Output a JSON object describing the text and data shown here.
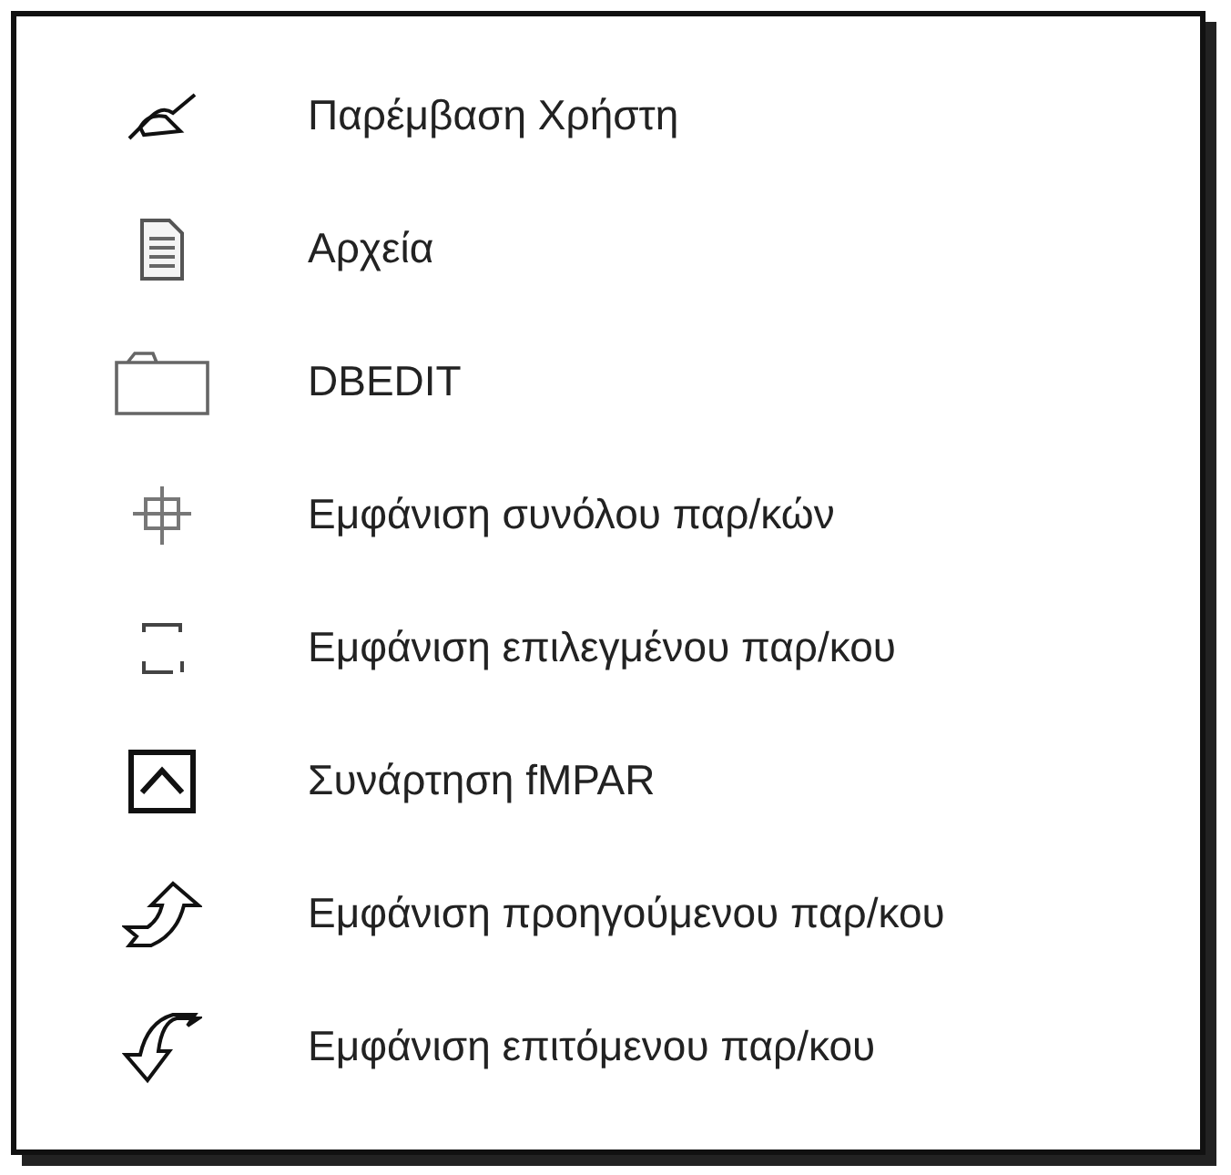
{
  "menu": {
    "items": [
      {
        "kind": "edit",
        "label": "Παρέμβαση Χρήστη"
      },
      {
        "kind": "file",
        "label": "Αρχεία"
      },
      {
        "kind": "folder",
        "label": "DBEDIT"
      },
      {
        "kind": "tree",
        "label": "Εμφάνιση συνόλου παρ/κών"
      },
      {
        "kind": "frame",
        "label": "Εμφάνιση επιλεγμένου παρ/κου"
      },
      {
        "kind": "function",
        "label": "Συνάρτηση fMPAR"
      },
      {
        "kind": "prev",
        "label": "Εμφάνιση προηγούμενου παρ/κου"
      },
      {
        "kind": "next",
        "label": "Εμφάνιση επιτόμενου παρ/κου"
      }
    ]
  }
}
